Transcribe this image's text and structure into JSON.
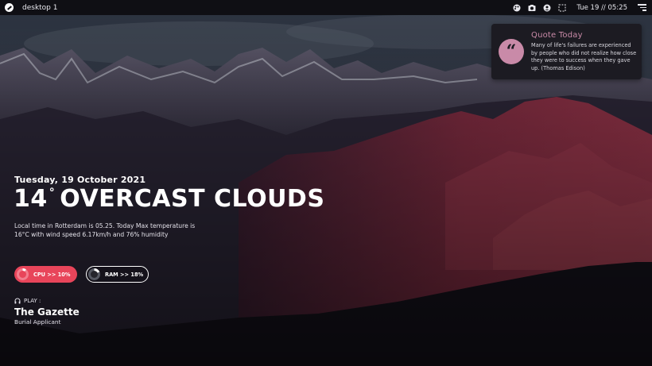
{
  "topbar": {
    "workspace": "desktop 1",
    "clock": "Tue 19 // 05:25",
    "icons": [
      "launcher-icon",
      "palette-icon",
      "camera-icon",
      "user-icon",
      "screen-icon",
      "menu-icon"
    ]
  },
  "quote": {
    "title": "Quote Today",
    "mark": "“",
    "text": "Many of life's failures are experienced by people who did not realize how close they were to success when they gave up. (Thomas Edison)"
  },
  "info": {
    "date": "Tuesday, 19 October 2021",
    "temperature": "14",
    "degree": "°",
    "condition": "OVERCAST CLOUDS",
    "description": "Local time in Rotterdam  is 05.25. Today Max temperature is 16°C with wind speed 6.17km/h and 76% humidity"
  },
  "stats": {
    "cpu_label": "CPU >> 10%",
    "cpu_value": 10,
    "ram_label": "RAM >> 18%",
    "ram_value": 18
  },
  "player": {
    "play_label": "PLAY :",
    "title": "The Gazette",
    "artist": "Burial Applicant"
  },
  "colors": {
    "accent": "#e8455a",
    "quote_accent": "#c98aa8",
    "bar": "#0f0f14"
  }
}
